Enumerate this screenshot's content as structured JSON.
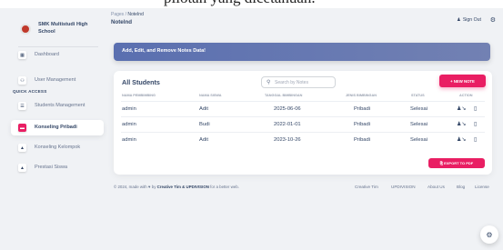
{
  "top_fragment": "pilotan yang dicetahuan.",
  "brand": {
    "name": "SMK Multistudi High School"
  },
  "sidebar": {
    "items": [
      {
        "label": "Dashboard",
        "icon": "dashboard-icon",
        "glyph": "▦"
      },
      {
        "label": "User Management",
        "icon": "user-group-icon",
        "glyph": "⚇"
      }
    ],
    "section_label": "QUICK ACCESS",
    "quick_items": [
      {
        "label": "Students Management",
        "icon": "list-icon",
        "glyph": "☰"
      },
      {
        "label": "Konseling Pribadi",
        "icon": "counseling-icon",
        "glyph": "▬",
        "active": true
      },
      {
        "label": "Konseling Kelompok",
        "icon": "group-counseling-icon",
        "glyph": "▲"
      },
      {
        "label": "Prestasi Siswa",
        "icon": "achievement-icon",
        "glyph": "▲"
      }
    ]
  },
  "navbar": {
    "breadcrumb_root": "Pages",
    "breadcrumb_sep": " / ",
    "breadcrumb_current": "NoteInd",
    "title": "NoteInd",
    "signout": "Sign Out"
  },
  "banner": {
    "text": "Add, Edit, and Remove Notes Data!"
  },
  "table": {
    "title": "All Students",
    "search_placeholder": "Search by Notes",
    "new_button": "+ NEW NOTE",
    "columns": [
      "NAMA PEMBIMBING",
      "NAMA SISWA",
      "TANGGAL BIMBINGAN",
      "JENIS BIMBINGAN",
      "STATUS",
      "ACTION"
    ],
    "rows": [
      {
        "pembimbing": "admin",
        "siswa": "Adit",
        "tanggal": "2025-06-06",
        "jenis": "Pribadi",
        "status": "Selesai"
      },
      {
        "pembimbing": "admin",
        "siswa": "Budi",
        "tanggal": "2022-01-01",
        "jenis": "Pribadi",
        "status": "Selesai"
      },
      {
        "pembimbing": "admin",
        "siswa": "Adit",
        "tanggal": "2023-10-26",
        "jenis": "Pribadi",
        "status": "Selesai"
      }
    ],
    "export_button": "⎘ EXPORT TO PDF"
  },
  "footer": {
    "copyright": "© 2024, made with",
    "by": "by",
    "creators": "Creative Tim & UPDIVISION",
    "suffix": "for a better web.",
    "links": [
      "Creative Tim",
      "UPDIVISION",
      "About Us",
      "Blog",
      "License"
    ]
  },
  "colors": {
    "accent": "#e91e63",
    "banner": "#6474b0",
    "text": "#344767"
  }
}
